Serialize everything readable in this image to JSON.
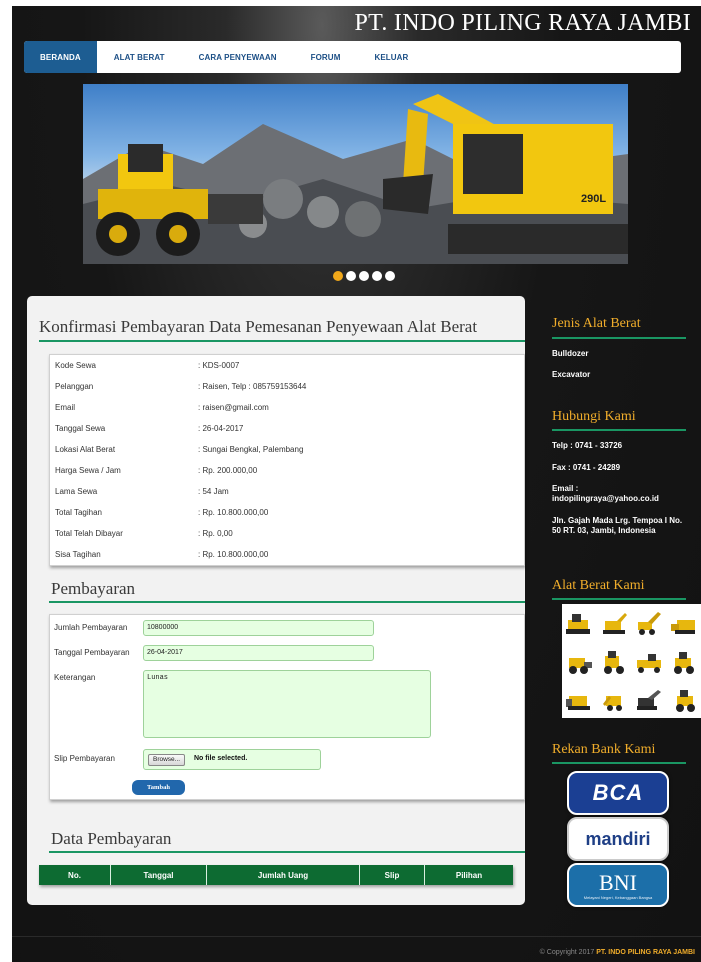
{
  "header": {
    "site_title": "PT. INDO PILING RAYA JAMBI"
  },
  "nav": {
    "items": [
      "BERANDA",
      "ALAT BERAT",
      "CARA PENYEWAAN",
      "FORUM",
      "KELUAR"
    ],
    "active": "BERANDA"
  },
  "slider": {
    "total": 5,
    "active_index": 0,
    "machine_label": "290L"
  },
  "confirm": {
    "title": "Konfirmasi Pembayaran Data Pemesanan Penyewaan Alat Berat",
    "rows": [
      {
        "label": "Kode Sewa",
        "value": ": KDS-0007"
      },
      {
        "label": "Pelanggan",
        "value": ": Raisen, Telp : 085759153644"
      },
      {
        "label": "Email",
        "value": ": raisen@gmail.com"
      },
      {
        "label": "Tanggal Sewa",
        "value": ": 26-04-2017"
      },
      {
        "label": "Lokasi Alat Berat",
        "value": ": Sungai Bengkal, Palembang"
      },
      {
        "label": "Harga Sewa / Jam",
        "value": ": Rp. 200.000,00"
      },
      {
        "label": "Lama Sewa",
        "value": ": 54 Jam"
      },
      {
        "label": "Total Tagihan",
        "value": ": Rp. 10.800.000,00"
      },
      {
        "label": "Total Telah Dibayar",
        "value": ": Rp. 0,00"
      },
      {
        "label": "Sisa Tagihan",
        "value": ": Rp. 10.800.000,00"
      }
    ]
  },
  "payment": {
    "title": "Pembayaran",
    "amount_label": "Jumlah Pembayaran",
    "amount_value": "10800000",
    "date_label": "Tanggal Pembayaran",
    "date_value": "26-04-2017",
    "note_label": "Keterangan",
    "note_value": "Lunas",
    "slip_label": "Slip Pembayaran",
    "browse_label": "Browse...",
    "no_file": "No file selected.",
    "submit_label": "Tambah"
  },
  "history": {
    "title": "Data Pembayaran",
    "columns": [
      "No.",
      "Tanggal",
      "Jumlah Uang",
      "Slip",
      "Pilihan"
    ]
  },
  "sidebar": {
    "types_title": "Jenis Alat Berat",
    "types": [
      "Bulldozer",
      "Excavator"
    ],
    "contact_title": "Hubungi Kami",
    "phone": "Telp : 0741 - 33726",
    "fax": "Fax : 0741 - 24289",
    "email_label": "Email :",
    "email": "indopilingraya@yahoo.co.id",
    "address": "Jln. Gajah Mada Lrg. Tempoa I No. 50 RT. 03, Jambi, Indonesia",
    "gallery_title": "Alat Berat Kami",
    "bank_title": "Rekan Bank Kami",
    "banks": [
      "BCA",
      "mandiri",
      "BNI"
    ],
    "bni_tagline": "Melayani Negeri, Kebanggaan Bangsa"
  },
  "footer": {
    "copyright": "© Copyright 2017",
    "company": "PT. INDO PILING RAYA JAMBI"
  },
  "colors": {
    "accent_green": "#1a9663",
    "nav_blue": "#1d5d92",
    "sidebar_orange": "#f0ad2b",
    "input_green": "#e6ffe2",
    "table_green": "#0d6b32"
  }
}
